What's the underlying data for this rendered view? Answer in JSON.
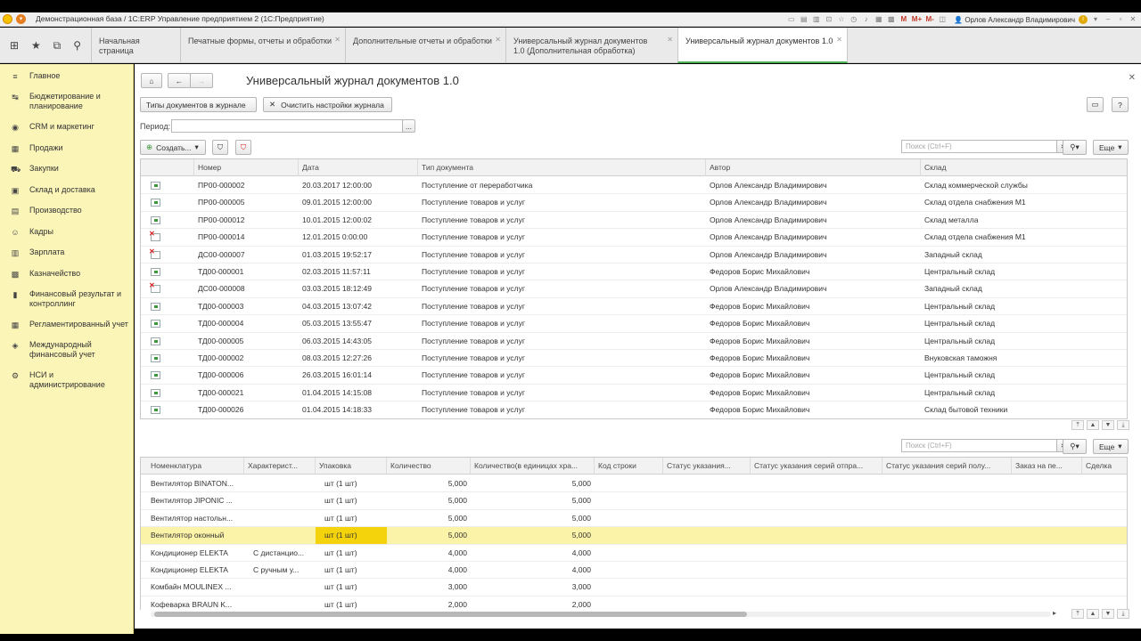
{
  "window": {
    "title": "Демонстрационная база / 1С:ERP Управление предприятием 2  (1С:Предприятие)",
    "user": "Орлов Александр Владимирович",
    "tools": [
      "M",
      "M+",
      "M-"
    ]
  },
  "tabs": [
    {
      "label": "Начальная страница",
      "closable": false
    },
    {
      "label": "Печатные формы, отчеты и обработки",
      "closable": true
    },
    {
      "label": "Дополнительные отчеты и обработки",
      "closable": true
    },
    {
      "label": "Универсальный журнал документов 1.0 (Дополнительная обработка)",
      "closable": true
    },
    {
      "label": "Универсальный журнал документов 1.0",
      "closable": true,
      "active": true
    }
  ],
  "sidebar": {
    "items": [
      {
        "label": "Главное",
        "icon": "menu-icon"
      },
      {
        "label": "Бюджетирование и планирование",
        "icon": "budget-icon"
      },
      {
        "label": "CRM и маркетинг",
        "icon": "crm-icon"
      },
      {
        "label": "Продажи",
        "icon": "sales-icon"
      },
      {
        "label": "Закупки",
        "icon": "cart-icon"
      },
      {
        "label": "Склад и доставка",
        "icon": "warehouse-icon"
      },
      {
        "label": "Производство",
        "icon": "factory-icon"
      },
      {
        "label": "Кадры",
        "icon": "people-icon"
      },
      {
        "label": "Зарплата",
        "icon": "salary-icon"
      },
      {
        "label": "Казначейство",
        "icon": "treasury-icon"
      },
      {
        "label": "Финансовый результат и контроллинг",
        "icon": "chart-icon"
      },
      {
        "label": "Регламентированный учет",
        "icon": "regulated-icon"
      },
      {
        "label": "Международный финансовый учет",
        "icon": "international-icon"
      },
      {
        "label": "НСИ и администрирование",
        "icon": "gear-icon"
      }
    ]
  },
  "main": {
    "title": "Универсальный журнал документов 1.0",
    "btn_doc_types": "Типы документов в журнале",
    "btn_clear": "Очистить настройки журнала",
    "period_label": "Период:",
    "period_value": "",
    "create_label": "Создать...",
    "search_placeholder": "Поиск (Ctrl+F)",
    "more_label": "Еще"
  },
  "docs": {
    "columns": [
      "Номер",
      "Дата",
      "Тип документа",
      "Автор",
      "Склад"
    ],
    "rows": [
      {
        "status": "posted",
        "num": "ПР00-000002",
        "date": "20.03.2017 12:00:00",
        "type": "Поступление от переработчика",
        "author": "Орлов Александр Владимирович",
        "wh": "Склад коммерческой службы"
      },
      {
        "status": "posted",
        "num": "ПР00-000005",
        "date": "09.01.2015 12:00:00",
        "type": "Поступление товаров и услуг",
        "author": "Орлов Александр Владимирович",
        "wh": "Склад отдела снабжения М1"
      },
      {
        "status": "posted",
        "num": "ПР00-000012",
        "date": "10.01.2015 12:00:02",
        "type": "Поступление товаров и услуг",
        "author": "Орлов Александр Владимирович",
        "wh": "Склад металла"
      },
      {
        "status": "deleted",
        "num": "ПР00-000014",
        "date": "12.01.2015 0:00:00",
        "type": "Поступление товаров и услуг",
        "author": "Орлов Александр Владимирович",
        "wh": "Склад отдела снабжения М1"
      },
      {
        "status": "deleted",
        "num": "ДС00-000007",
        "date": "01.03.2015 19:52:17",
        "type": "Поступление товаров и услуг",
        "author": "Орлов Александр Владимирович",
        "wh": "Западный склад"
      },
      {
        "status": "posted",
        "num": "ТД00-000001",
        "date": "02.03.2015 11:57:11",
        "type": "Поступление товаров и услуг",
        "author": "Федоров Борис Михайлович",
        "wh": "Центральный склад"
      },
      {
        "status": "deleted",
        "num": "ДС00-000008",
        "date": "03.03.2015 18:12:49",
        "type": "Поступление товаров и услуг",
        "author": "Орлов Александр Владимирович",
        "wh": "Западный склад"
      },
      {
        "status": "posted",
        "num": "ТД00-000003",
        "date": "04.03.2015 13:07:42",
        "type": "Поступление товаров и услуг",
        "author": "Федоров Борис Михайлович",
        "wh": "Центральный склад"
      },
      {
        "status": "posted",
        "num": "ТД00-000004",
        "date": "05.03.2015 13:55:47",
        "type": "Поступление товаров и услуг",
        "author": "Федоров Борис Михайлович",
        "wh": "Центральный склад"
      },
      {
        "status": "posted",
        "num": "ТД00-000005",
        "date": "06.03.2015 14:43:05",
        "type": "Поступление товаров и услуг",
        "author": "Федоров Борис Михайлович",
        "wh": "Центральный склад"
      },
      {
        "status": "posted",
        "num": "ТД00-000002",
        "date": "08.03.2015 12:27:26",
        "type": "Поступление товаров и услуг",
        "author": "Федоров Борис Михайлович",
        "wh": "Внуковская таможня"
      },
      {
        "status": "posted",
        "num": "ТД00-000006",
        "date": "26.03.2015 16:01:14",
        "type": "Поступление товаров и услуг",
        "author": "Федоров Борис Михайлович",
        "wh": "Центральный склад"
      },
      {
        "status": "posted",
        "num": "ТД00-000021",
        "date": "01.04.2015 14:15:08",
        "type": "Поступление товаров и услуг",
        "author": "Федоров Борис Михайлович",
        "wh": "Центральный склад"
      },
      {
        "status": "posted",
        "num": "ТД00-000026",
        "date": "01.04.2015 14:18:33",
        "type": "Поступление товаров и услуг",
        "author": "Федоров Борис Михайлович",
        "wh": "Склад бытовой техники"
      }
    ]
  },
  "goods": {
    "columns": [
      "Номенклатура",
      "Характерист...",
      "Упаковка",
      "Количество",
      "Количество(в единицах хра...",
      "Код строки",
      "Статус указания...",
      "Статус указания серий отпра...",
      "Статус указания серий полу...",
      "Заказ на пе...",
      "Сделка"
    ],
    "rows": [
      {
        "name": "Вентилятор BINATON...",
        "char": "",
        "pack": "шт (1 шт)",
        "qty": "5,000",
        "qty_store": "5,000"
      },
      {
        "name": "Вентилятор JIPONIC ...",
        "char": "",
        "pack": "шт (1 шт)",
        "qty": "5,000",
        "qty_store": "5,000"
      },
      {
        "name": "Вентилятор настольн...",
        "char": "",
        "pack": "шт (1 шт)",
        "qty": "5,000",
        "qty_store": "5,000"
      },
      {
        "name": "Вентилятор оконный",
        "char": "",
        "pack": "шт (1 шт)",
        "qty": "5,000",
        "qty_store": "5,000",
        "selected": true
      },
      {
        "name": "Кондиционер ELEKTA",
        "char": "С дистанцио...",
        "pack": "шт (1 шт)",
        "qty": "4,000",
        "qty_store": "4,000"
      },
      {
        "name": "Кондиционер ELEKTA",
        "char": "С ручным у...",
        "pack": "шт (1 шт)",
        "qty": "4,000",
        "qty_store": "4,000"
      },
      {
        "name": "Комбайн MOULINEX ...",
        "char": "",
        "pack": "шт (1 шт)",
        "qty": "3,000",
        "qty_store": "3,000"
      },
      {
        "name": "Кофеварка BRAUN K...",
        "char": "",
        "pack": "шт (1 шт)",
        "qty": "2,000",
        "qty_store": "2,000"
      }
    ]
  }
}
